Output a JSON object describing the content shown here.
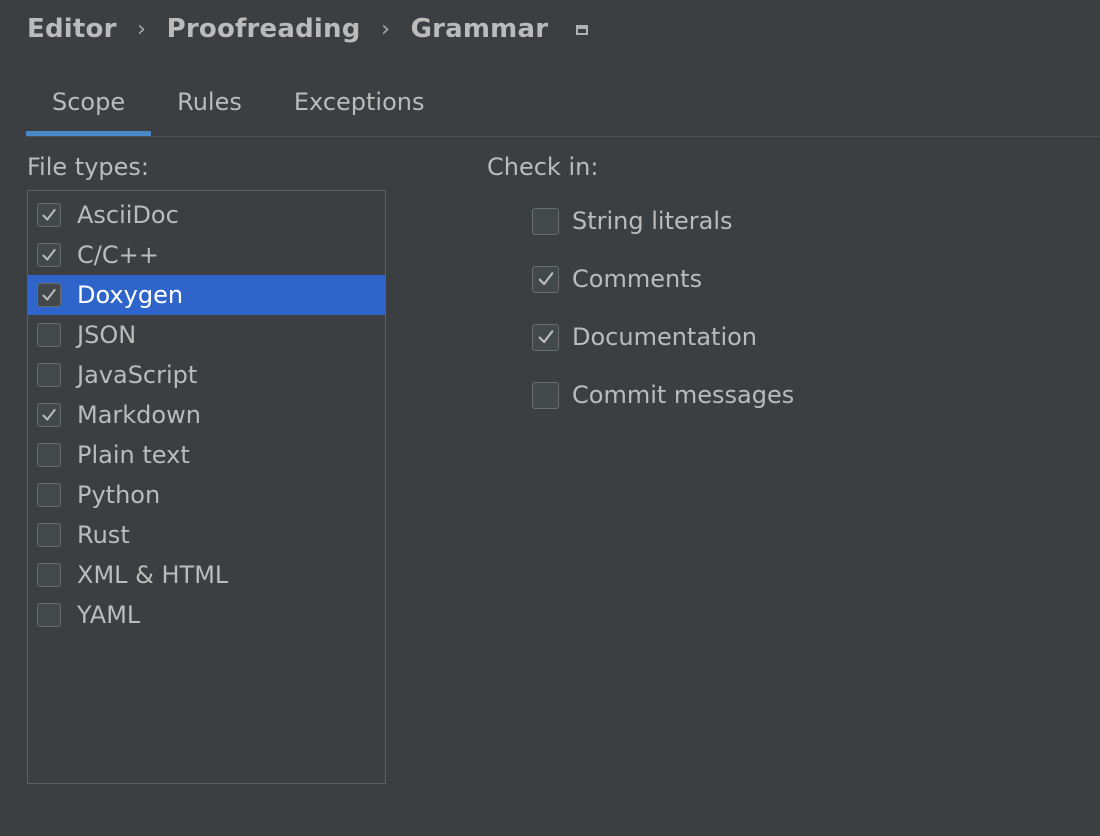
{
  "breadcrumb": {
    "items": [
      "Editor",
      "Proofreading",
      "Grammar"
    ],
    "separator": "›"
  },
  "tabs": [
    {
      "label": "Scope",
      "selected": true
    },
    {
      "label": "Rules",
      "selected": false
    },
    {
      "label": "Exceptions",
      "selected": false
    }
  ],
  "file_types": {
    "label": "File types:",
    "items": [
      {
        "label": "AsciiDoc",
        "checked": true,
        "selected": false
      },
      {
        "label": "C/C++",
        "checked": true,
        "selected": false
      },
      {
        "label": "Doxygen",
        "checked": true,
        "selected": true
      },
      {
        "label": "JSON",
        "checked": false,
        "selected": false
      },
      {
        "label": "JavaScript",
        "checked": false,
        "selected": false
      },
      {
        "label": "Markdown",
        "checked": true,
        "selected": false
      },
      {
        "label": "Plain text",
        "checked": false,
        "selected": false
      },
      {
        "label": "Python",
        "checked": false,
        "selected": false
      },
      {
        "label": "Rust",
        "checked": false,
        "selected": false
      },
      {
        "label": "XML & HTML",
        "checked": false,
        "selected": false
      },
      {
        "label": "YAML",
        "checked": false,
        "selected": false
      }
    ]
  },
  "check_in": {
    "label": "Check in:",
    "items": [
      {
        "label": "String literals",
        "checked": false
      },
      {
        "label": "Comments",
        "checked": true
      },
      {
        "label": "Documentation",
        "checked": true
      },
      {
        "label": "Commit messages",
        "checked": false
      }
    ]
  },
  "colors": {
    "background": "#3c3f41",
    "selection": "#2f65ca",
    "tab_underline": "#4a88c7",
    "text": "#bbbbbb"
  }
}
